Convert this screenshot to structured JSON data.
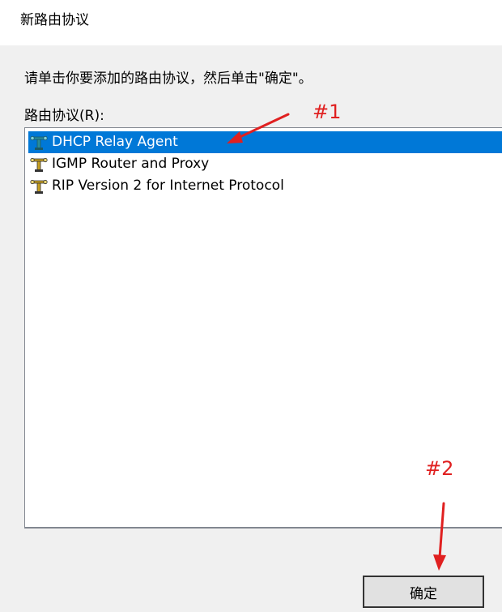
{
  "window": {
    "title": "新路由协议"
  },
  "dialog": {
    "instruction": "请单击你要添加的路由协议，然后单击\"确定\"。",
    "list_label": "路由协议(R):",
    "protocols": [
      {
        "label": "DHCP Relay Agent",
        "icon": "network-protocol-icon",
        "selected": true
      },
      {
        "label": "IGMP Router and Proxy",
        "icon": "network-protocol-icon",
        "selected": false
      },
      {
        "label": "RIP Version 2 for Internet Protocol",
        "icon": "network-protocol-icon",
        "selected": false
      }
    ],
    "ok_label": "确定"
  },
  "annotations": {
    "step1": "#1",
    "step2": "#2",
    "color": "#e02020"
  },
  "colors": {
    "selection": "#0078d7",
    "dialog_background": "#f0f0f0",
    "icon_teal": "#2a8c9a",
    "icon_gold": "#c8a020"
  }
}
